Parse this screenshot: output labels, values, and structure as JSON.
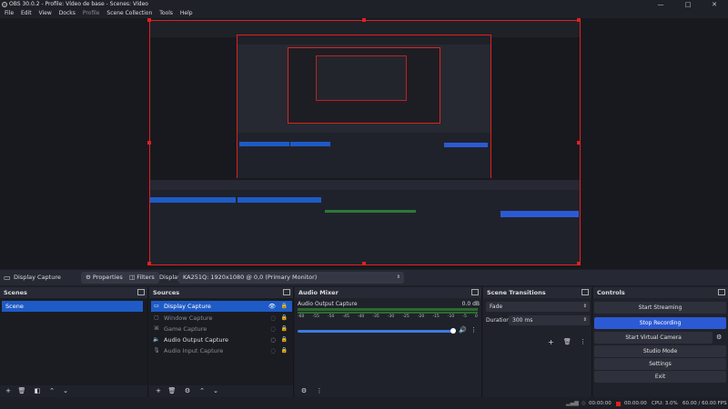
{
  "window": {
    "title": "OBS 30.0.2 - Profile: Vídeo de base - Scenes: Vídeo",
    "minimize": "—",
    "maximize": "□",
    "close": "✕"
  },
  "menu": [
    "File",
    "Edit",
    "View",
    "Docks",
    "Profile",
    "Scene Collection",
    "Tools",
    "Help"
  ],
  "source_toolbar": {
    "source_name": "Display Capture",
    "properties": "Properties",
    "filters": "Filters",
    "display_label": "Display",
    "display_value": "KA251Q: 1920x1080 @ 0,0 (Primary Monitor)"
  },
  "scenes": {
    "title": "Scenes",
    "items": [
      "Scene"
    ]
  },
  "sources": {
    "title": "Sources",
    "items": [
      {
        "label": "Display Capture",
        "icon": "monitor-icon",
        "selected": true,
        "visible": true
      },
      {
        "label": "Window Capture",
        "icon": "window-icon",
        "selected": false,
        "visible": false
      },
      {
        "label": "Game Capture",
        "icon": "gamepad-icon",
        "selected": false,
        "visible": false
      },
      {
        "label": "Audio Output Capture",
        "icon": "speaker-icon",
        "selected": false,
        "visible": true
      },
      {
        "label": "Audio Input Capture",
        "icon": "microphone-icon",
        "selected": false,
        "visible": false
      }
    ]
  },
  "audio_mixer": {
    "title": "Audio Mixer",
    "channel": "Audio Output Capture",
    "level": "0.0 dB",
    "scale": [
      "-60",
      "-55",
      "-50",
      "-45",
      "-40",
      "-35",
      "-30",
      "-25",
      "-20",
      "-15",
      "-10",
      "-5",
      "0"
    ]
  },
  "scene_transitions": {
    "title": "Scene Transitions",
    "transition": "Fade",
    "duration_label": "Duration",
    "duration_value": "300 ms"
  },
  "controls": {
    "title": "Controls",
    "buttons": [
      "Start Streaming",
      "Stop Recording",
      "Start Virtual Camera",
      "Studio Mode",
      "Settings",
      "Exit"
    ],
    "active": "Stop Recording"
  },
  "status": {
    "stream_time": "00:00:00",
    "rec_time": "00:00:00",
    "cpu": "CPU: 3.0%",
    "fps": "60.00 / 60.00 FPS"
  },
  "colors": {
    "accent": "#1e5bc6",
    "recording": "#2c5ad4",
    "frame": "#e02020"
  }
}
